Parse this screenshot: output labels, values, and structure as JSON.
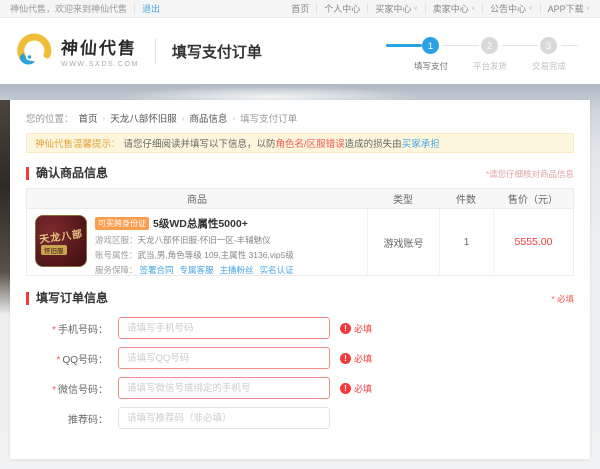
{
  "icons": {
    "chevron_down": "∨",
    "exclaim": "!",
    "breadcrumb_sep": "›"
  },
  "colors": {
    "accent_blue": "#2aa2e3",
    "link_blue": "#46a6e6",
    "price_red": "#f23c3c",
    "required_red": "#f25555",
    "warn_orange": "#e6a23c",
    "tag_orange": "#ff9d4e",
    "notice_bg": "#fdf6dd"
  },
  "topbar": {
    "welcome": "神仙代售，欢迎来到神仙代售",
    "logout": "退出",
    "links": [
      {
        "label": "首页"
      },
      {
        "label": "个人中心"
      },
      {
        "label": "买家中心"
      },
      {
        "label": "卖家中心"
      },
      {
        "label": "公告中心"
      },
      {
        "label": "APP下载"
      }
    ]
  },
  "header": {
    "brand_name": "神仙代售",
    "brand_url": "WWW.SXDS.COM",
    "page_title": "填写支付订单",
    "steps": [
      {
        "num": "1",
        "label": "填写支付"
      },
      {
        "num": "2",
        "label": "平台发货"
      },
      {
        "num": "3",
        "label": "交易完成"
      }
    ]
  },
  "breadcrumb": {
    "prefix": "您的位置：",
    "items": [
      "首页",
      "天龙八部怀旧服",
      "商品信息",
      "填写支付订单"
    ]
  },
  "notice": {
    "prefix": "神仙代售温馨提示：",
    "text1": "请您仔细阅读并填写以下信息，以防",
    "highlight": "角色名/区服错误",
    "text2": "造成的损失由",
    "link": "买家承担"
  },
  "product_section": {
    "title": "确认商品信息",
    "hint": "*请您仔细核对商品信息",
    "table": {
      "headers": [
        "商品",
        "类型",
        "件数",
        "售价（元）"
      ]
    },
    "product": {
      "image_line1": "天龙八部",
      "image_line2": "怀旧服",
      "tag": "可买跨身份证",
      "title": "5级WD总属性5000+",
      "region_label": "游戏区服：",
      "region_value": "天龙八部怀旧服-怀旧一区-丰辅魅仪",
      "attr_label": "账号属性：",
      "attr_value": "武当,男,角色等级 109,主属性 3136,vip5级",
      "service_label": "服务保障：",
      "services": [
        "签署合同",
        "专属客服",
        "主播粉丝",
        "实名认证"
      ],
      "type": "游戏账号",
      "count": "1",
      "price": "5555.00"
    }
  },
  "order_section": {
    "title": "填写订单信息",
    "hint": "* 必填",
    "badge": "必填",
    "fields": [
      {
        "star": "*",
        "label": "手机号码：",
        "placeholder": "请填写手机号码",
        "required": true
      },
      {
        "star": "*",
        "label": "QQ号码：",
        "placeholder": "请填写QQ号码",
        "required": true
      },
      {
        "star": "*",
        "label": "微信号码：",
        "placeholder": "请填写微信号或绑定的手机号",
        "required": true
      },
      {
        "star": "",
        "label": "推荐码：",
        "placeholder": "请填写推荐码（非必填）",
        "required": false
      }
    ]
  }
}
